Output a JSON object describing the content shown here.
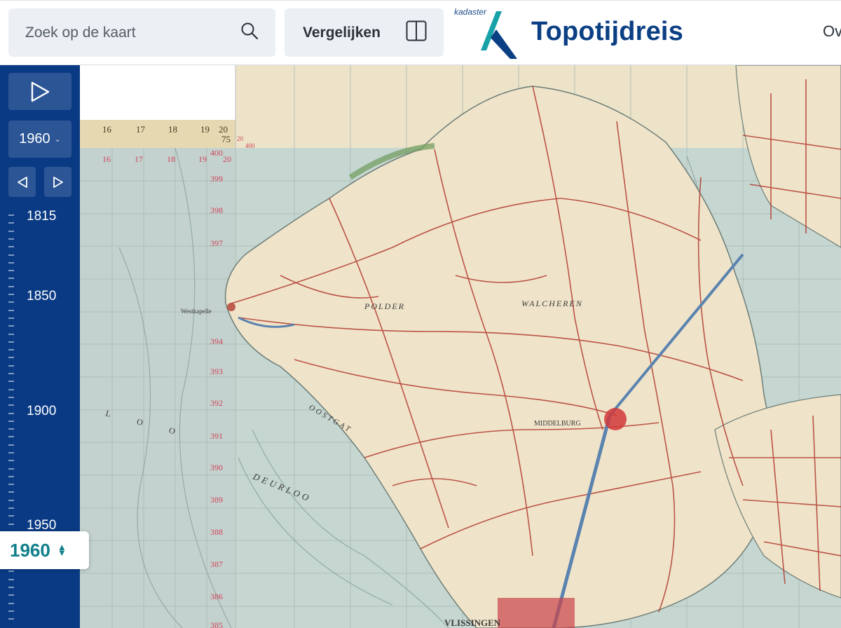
{
  "header": {
    "search": {
      "placeholder": "Zoek op de kaart",
      "value": ""
    },
    "compare_label": "Vergelijken",
    "logo_brand": "kadaster",
    "logo_title": "Topotijdreis",
    "nav_partial": "Ov"
  },
  "timeline": {
    "selected_year": "1960",
    "current_year": "1960",
    "years": [
      "1815",
      "1850",
      "1900",
      "1950"
    ]
  },
  "map": {
    "grid_row_labels": [
      "400",
      "399",
      "398",
      "397",
      "394",
      "393",
      "392",
      "391",
      "390",
      "389",
      "388",
      "387",
      "386",
      "385"
    ],
    "grid_col_labels": [
      "16",
      "17",
      "18",
      "19",
      "20"
    ],
    "ruler_top_labels": [
      "16",
      "17",
      "18",
      "19",
      "20",
      "75"
    ],
    "sheet_corner_labels": [
      "20",
      "400"
    ],
    "place_names": [
      "Westkapelle",
      "POLDER",
      "WALCHEREN",
      "MIDDELBURG",
      "VLISSINGEN",
      "DEURLOO",
      "OOSTGAT",
      "L O O"
    ],
    "colors": {
      "sea": "#c6d6d0",
      "land": "#efe4c9",
      "roads": "#b23a30",
      "canals": "#5b83b0",
      "grid_labels": "#d2445a"
    }
  },
  "icons": [
    "search-icon",
    "split-view-icon",
    "play-icon",
    "chevron-down-icon",
    "prev-icon",
    "next-icon",
    "updown-icon",
    "kadaster-logo"
  ]
}
